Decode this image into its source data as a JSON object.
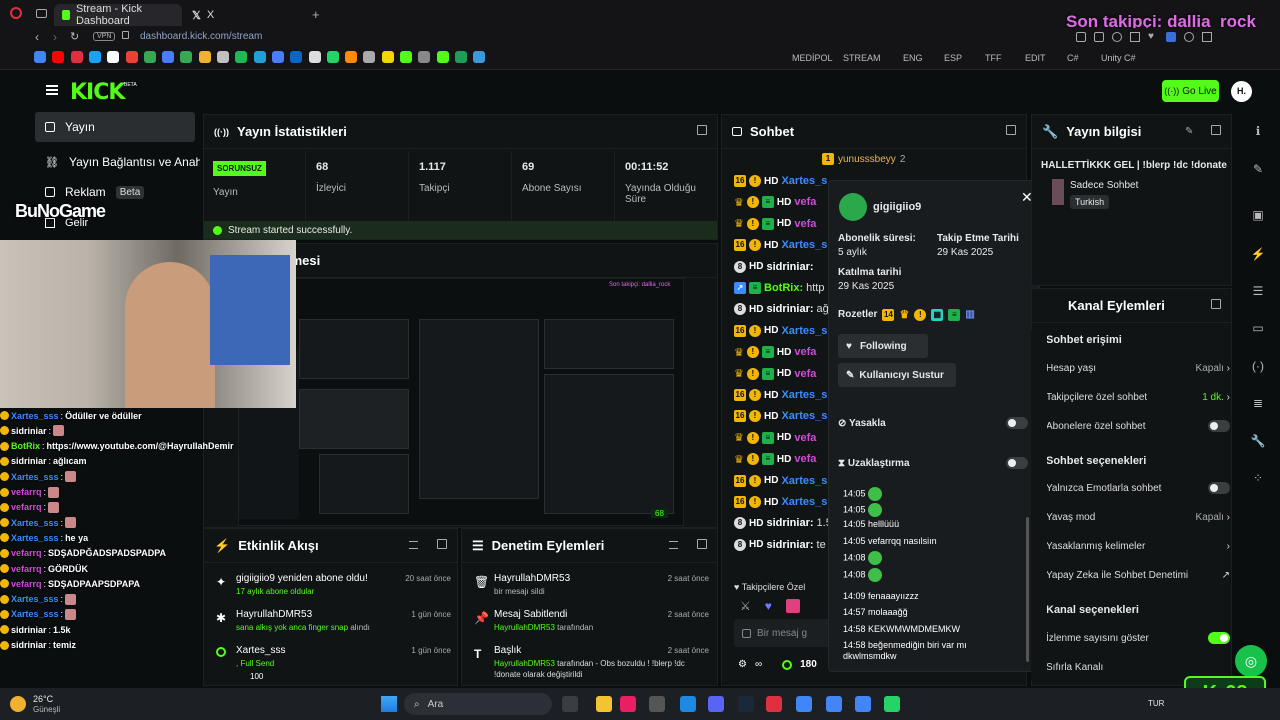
{
  "browser": {
    "tab_title": "Stream - Kick Dashboard",
    "tab2_title": "X",
    "url": "dashboard.kick.com/stream",
    "vpn": "VPN",
    "bookmarks": [
      "MEDİPOL",
      "STREAM",
      "ENG",
      "ESP",
      "TFF",
      "EDIT",
      "C#",
      "Unity C#"
    ]
  },
  "overlay_follower": "Son takipçi: dallia_rock",
  "header": {
    "logo": "KICK",
    "beta": "BETA",
    "go_live": "Go Live",
    "avatar": "H."
  },
  "sidebar": {
    "items": [
      {
        "label": "Yayın"
      },
      {
        "label": "Yayın Bağlantısı ve Anahtarı"
      },
      {
        "label": "Reklam",
        "badge": "Beta"
      },
      {
        "label": "Gelir"
      }
    ]
  },
  "stats": {
    "title": "Yayın İstatistikleri",
    "status": "SORUNSUZ",
    "status_label": "Yayın",
    "items": [
      {
        "value": "68",
        "label": "İzleyici"
      },
      {
        "value": "1.117",
        "label": "Takipçi"
      },
      {
        "value": "69",
        "label": "Abone Sayısı"
      },
      {
        "value": "00:11:52",
        "label": "Yayında Olduğu Süre"
      }
    ],
    "success": "Stream started successfully."
  },
  "preview": {
    "title": "Yayın Önizlemesi"
  },
  "activity": {
    "title": "Etkinlik Akışı",
    "items": [
      {
        "title": "gigiigiio9 yeniden abone oldu!",
        "sub": "17 aylık abone oldular",
        "time": "20 saat önce"
      },
      {
        "title": "HayrullahDMR53",
        "sub": "sana alkış yok anca finger snap",
        "sub2": "alındı",
        "time": "1 gün önce"
      },
      {
        "title": "Xartes_sss",
        "sub": ", Full Send",
        "sub2": "100",
        "time": "1 gün önce"
      }
    ]
  },
  "moderation": {
    "title": "Denetim Eylemleri",
    "items": [
      {
        "title": "HayrullahDMR53",
        "sub": "bir mesajı sildi",
        "time": "2 saat önce"
      },
      {
        "title": "Mesaj Sabitlendi",
        "sub": "HayrullahDMR53",
        "sub2": "tarafından",
        "time": "2 saat önce"
      },
      {
        "title": "Başlık",
        "sub": "HayrullahDMR53",
        "sub2": "tarafından - Obs bozuldu ! !blerp !dc !donate olarak değiştirildi",
        "time": "2 saat önce"
      }
    ]
  },
  "chat": {
    "title": "Sohbet",
    "pinned_user": "yunusssbeyy",
    "pinned_count": "2",
    "lines": [
      {
        "user": "Xartes_s",
        "color": "#3b8cff",
        "text": ""
      },
      {
        "user": "vefa",
        "color": "#d04bd8",
        "text": ""
      },
      {
        "user": "vefa",
        "color": "#d04bd8",
        "text": ""
      },
      {
        "user": "Xartes_s",
        "color": "#3b8cff",
        "text": ""
      },
      {
        "user": "sidriniar:",
        "color": "#ffffff",
        "text": ""
      },
      {
        "user": "BotRix:",
        "color": "#53fc18",
        "text": "http"
      },
      {
        "user": "sidriniar:",
        "color": "#ffffff",
        "text": "ağ"
      },
      {
        "user": "Xartes_s",
        "color": "#3b8cff",
        "text": ""
      },
      {
        "user": "vefa",
        "color": "#d04bd8",
        "text": ""
      },
      {
        "user": "vefa",
        "color": "#d04bd8",
        "text": ""
      },
      {
        "user": "Xartes_s",
        "color": "#3b8cff",
        "text": ""
      },
      {
        "user": "Xartes_s",
        "color": "#3b8cff",
        "text": ""
      },
      {
        "user": "vefa",
        "color": "#d04bd8",
        "text": ""
      },
      {
        "user": "vefa",
        "color": "#d04bd8",
        "text": ""
      },
      {
        "user": "Xartes_s",
        "color": "#3b8cff",
        "text": ""
      },
      {
        "user": "Xartes_s",
        "color": "#3b8cff",
        "text": ""
      },
      {
        "user": "sidriniar:",
        "color": "#ffffff",
        "text": "1.5"
      },
      {
        "user": "sidriniar:",
        "color": "#ffffff",
        "text": "te"
      }
    ],
    "followers_only": "Takipçilere Özel",
    "placeholder": "Bir mesaj g",
    "viewer_count": "180"
  },
  "user_card": {
    "name": "gigiigiio9",
    "sub_label": "Abonelik süresi:",
    "sub_value": "5 aylık",
    "follow_label": "Takip Etme Tarihi",
    "follow_value": "29 Kas 2025",
    "join_label": "Katılma tarihi",
    "join_value": "29 Kas 2025",
    "badges_label": "Rozetler",
    "badge_num": "14",
    "following": "Following",
    "mute": "Kullanıcıyı Sustur",
    "ban": "Yasakla",
    "timeout": "Uzaklaştırma",
    "history": [
      {
        "t": "14:05",
        "m": ""
      },
      {
        "t": "14:05",
        "m": ""
      },
      {
        "t": "14:05",
        "m": "helllüüü"
      },
      {
        "t": "14:05",
        "m": "vefarrqq nasılsiın"
      },
      {
        "t": "14:08",
        "m": ""
      },
      {
        "t": "14:08",
        "m": ""
      },
      {
        "t": "14:09",
        "m": "fenaaayıızzz"
      },
      {
        "t": "14:57",
        "m": "molaaağğ"
      },
      {
        "t": "14:58",
        "m": "KEKWMWMDMEMKW"
      },
      {
        "t": "14:58",
        "m": "beğenmediğin biri var mı dkwlmsmdkw"
      }
    ]
  },
  "stream_info": {
    "title": "Yayın bilgisi",
    "stream_title": "HALLETTİKKK GEL | !blerp !dc !donate",
    "category": "Sadece Sohbet",
    "language": "Turkish"
  },
  "channel_actions": {
    "title": "Kanal Eylemleri",
    "chat_access": "Sohbet erişimi",
    "rows": [
      {
        "label": "Hesap yaşı",
        "value": "Kapalı"
      },
      {
        "label": "Takipçilere özel sohbet",
        "value": "1 dk."
      },
      {
        "label": "Abonelere özel sohbet",
        "value": ""
      }
    ],
    "chat_settings": "Sohbet seçenekleri",
    "rows2": [
      {
        "label": "Yalnızca Emotlarla sohbet",
        "value": ""
      },
      {
        "label": "Yavaş mod",
        "value": "Kapalı"
      },
      {
        "label": "Yasaklanmış kelimeler",
        "value": ""
      },
      {
        "label": "Yapay Zeka ile Sohbet Denetimi",
        "value": ""
      }
    ],
    "channel_settings": "Kanal seçenekleri",
    "rows3": [
      {
        "label": "İzlenme sayısını göster",
        "value": ""
      },
      {
        "label": "Sıfırla Kanalı",
        "value": ""
      }
    ]
  },
  "overlay_chat": [
    {
      "user": "Xartes_sss",
      "color": "#3b8cff",
      "text": "Ödüller ve ödüller"
    },
    {
      "user": "sidriniar",
      "color": "#ffffff",
      "text": ""
    },
    {
      "user": "BotRix",
      "color": "#53fc18",
      "text": "https://www.youtube.com/@HayrullahDemir"
    },
    {
      "user": "sidriniar",
      "color": "#ffffff",
      "text": "ağlıcam"
    },
    {
      "user": "Xartes_sss",
      "color": "#3b8cff",
      "text": ""
    },
    {
      "user": "vefarrq",
      "color": "#d04bd8",
      "text": ""
    },
    {
      "user": "vefarrq",
      "color": "#d04bd8",
      "text": ""
    },
    {
      "user": "Xartes_sss",
      "color": "#3b8cff",
      "text": ""
    },
    {
      "user": "Xartes_sss",
      "color": "#3b8cff",
      "text": "he ya"
    },
    {
      "user": "vefarrq",
      "color": "#d04bd8",
      "text": "SDŞADPĞADSPADSPADPA"
    },
    {
      "user": "vefarrq",
      "color": "#d04bd8",
      "text": "GÖRDÜK"
    },
    {
      "user": "vefarrq",
      "color": "#d04bd8",
      "text": "SDŞADPAAPSDPAPA"
    },
    {
      "user": "Xartes_sss",
      "color": "#3b8cff",
      "text": ""
    },
    {
      "user": "Xartes_sss",
      "color": "#3b8cff",
      "text": ""
    },
    {
      "user": "sidriniar",
      "color": "#ffffff",
      "text": "1.5k"
    },
    {
      "user": "sidriniar",
      "color": "#ffffff",
      "text": "temiz"
    }
  ],
  "webcam_overlay": {
    "brand": "BuNoGame"
  },
  "kick_counter": "68",
  "taskbar": {
    "weather": "26°C",
    "weather_sub": "Güneşli",
    "search": "Ara",
    "lang": "TUR"
  }
}
